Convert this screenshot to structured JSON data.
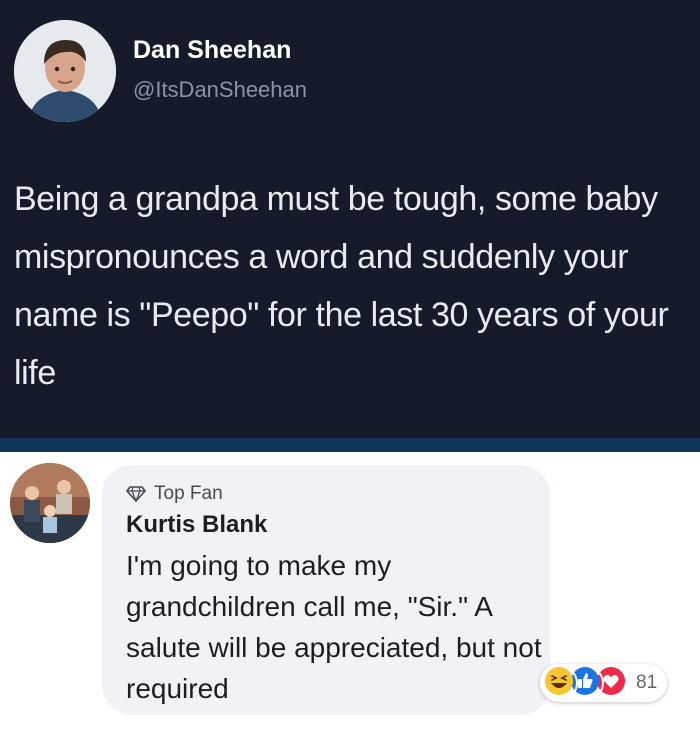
{
  "tweet": {
    "author_name": "Dan Sheehan",
    "author_handle": "@ItsDanSheehan",
    "text": "Being a grandpa must be tough, some baby mispronounces a word and suddenly your name is \"Peepo\" for the last 30 years of your life",
    "colors": {
      "background": "#151b2b",
      "divider": "#10355a"
    }
  },
  "comment": {
    "badge_label": "Top Fan",
    "badge_icon": "diamond-icon",
    "author_name": "Kurtis Blank",
    "text": "I'm going to make my grandchildren call me, \"Sir.\" A salute will be appreciated, but not required",
    "reactions": {
      "icons": [
        "haha-reaction-icon",
        "like-reaction-icon",
        "love-reaction-icon"
      ],
      "count": "81"
    }
  }
}
